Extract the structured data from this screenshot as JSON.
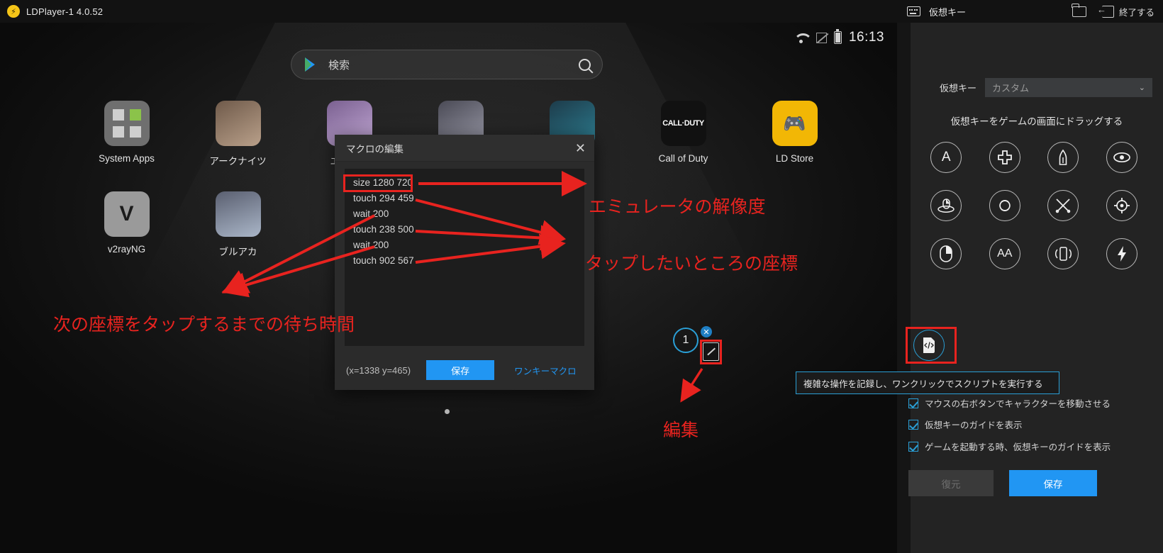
{
  "titlebar": {
    "app_title": "LDPlayer-1 4.0.52",
    "logo_icon": "ldplayer-logo-icon"
  },
  "panel_header": {
    "keyboard_icon": "keyboard-icon",
    "title": "仮想キー",
    "folder_icon": "folder-icon",
    "exit_icon": "exit-arrow-icon",
    "exit_label": "終了する"
  },
  "emulator": {
    "statusbar": {
      "wifi_icon": "wifi-icon",
      "signal_icon": "signal-off-icon",
      "battery_icon": "battery-icon",
      "clock": "16:13"
    },
    "search": {
      "play_icon": "google-play-icon",
      "placeholder": "検索",
      "search_icon": "search-icon"
    },
    "apps_row1": [
      {
        "name": "System Apps",
        "icon": "system-apps-icon"
      },
      {
        "name": "アークナイツ",
        "icon": "arknights-icon"
      },
      {
        "name": "エピック",
        "icon": "epic-icon"
      },
      {
        "name": "",
        "icon": "anime-app-icon"
      },
      {
        "name": "",
        "icon": "game-app-icon"
      },
      {
        "name": "Call of Duty",
        "icon": "call-of-duty-icon",
        "glyph": "CALL·DUTY"
      },
      {
        "name": "LD Store",
        "icon": "ld-store-icon",
        "glyph": "🎮"
      }
    ],
    "apps_row2": [
      {
        "name": "v2rayNG",
        "icon": "v2rayng-icon",
        "glyph": "V"
      },
      {
        "name": "ブルアカ",
        "icon": "blue-archive-icon"
      }
    ]
  },
  "dialog": {
    "title": "マクロの編集",
    "close_icon": "close-icon",
    "script_lines": [
      "size 1280 720",
      "touch 294 459",
      "wait 200",
      "touch 238 500",
      "wait 200",
      "touch 902 567"
    ],
    "coords": "(x=1338  y=465)",
    "save_label": "保存",
    "onekey_link": "ワンキーマクロ"
  },
  "annotations": {
    "resolution": "エミュレータの解像度",
    "coordinates": "タップしたいところの座標",
    "wait_time": "次の座標をタップするまでの待ち時間",
    "edit": "編集",
    "highlight_color": "#e8231f"
  },
  "key_marker": {
    "number": "1",
    "close_icon": "close-badge-icon",
    "edit_icon": "edit-pencil-icon"
  },
  "panel": {
    "vk_label": "仮想キー",
    "vk_selected": "カスタム",
    "vk_chevron": "chevron-down-icon",
    "drag_hint": "仮想キーをゲームの画面にドラッグする",
    "icons": [
      {
        "name": "key-a-icon",
        "glyph": "A"
      },
      {
        "name": "cross-heal-icon",
        "glyph": "✛"
      },
      {
        "name": "bullet-icon",
        "glyph": "▮"
      },
      {
        "name": "eye-view-icon",
        "glyph": "◉"
      },
      {
        "name": "mouse-rotate-icon",
        "glyph": "◓"
      },
      {
        "name": "rotate-arrows-icon",
        "glyph": "↻"
      },
      {
        "name": "crossed-swords-icon",
        "glyph": "⚔"
      },
      {
        "name": "crosshair-aim-icon",
        "glyph": "◎"
      },
      {
        "name": "mouse-icon",
        "glyph": "◑"
      },
      {
        "name": "text-aa-icon",
        "glyph": "AA"
      },
      {
        "name": "phone-shake-icon",
        "glyph": "▯"
      },
      {
        "name": "lightning-icon",
        "glyph": "⚡"
      }
    ],
    "script_icon": {
      "name": "script-macro-icon",
      "glyph": "</>"
    },
    "tooltip": "複雑な操作を記録し、ワンクリックでスクリプトを実行する",
    "checkboxes": [
      {
        "label": "マウスの右ボタンでキャラクターを移動させる",
        "checked": true
      },
      {
        "label": "仮想キーのガイドを表示",
        "checked": true
      },
      {
        "label": "ゲームを起動する時、仮想キーのガイドを表示",
        "checked": true
      }
    ],
    "restore_label": "復元",
    "save_label": "保存",
    "accent_color": "#2196f3"
  }
}
